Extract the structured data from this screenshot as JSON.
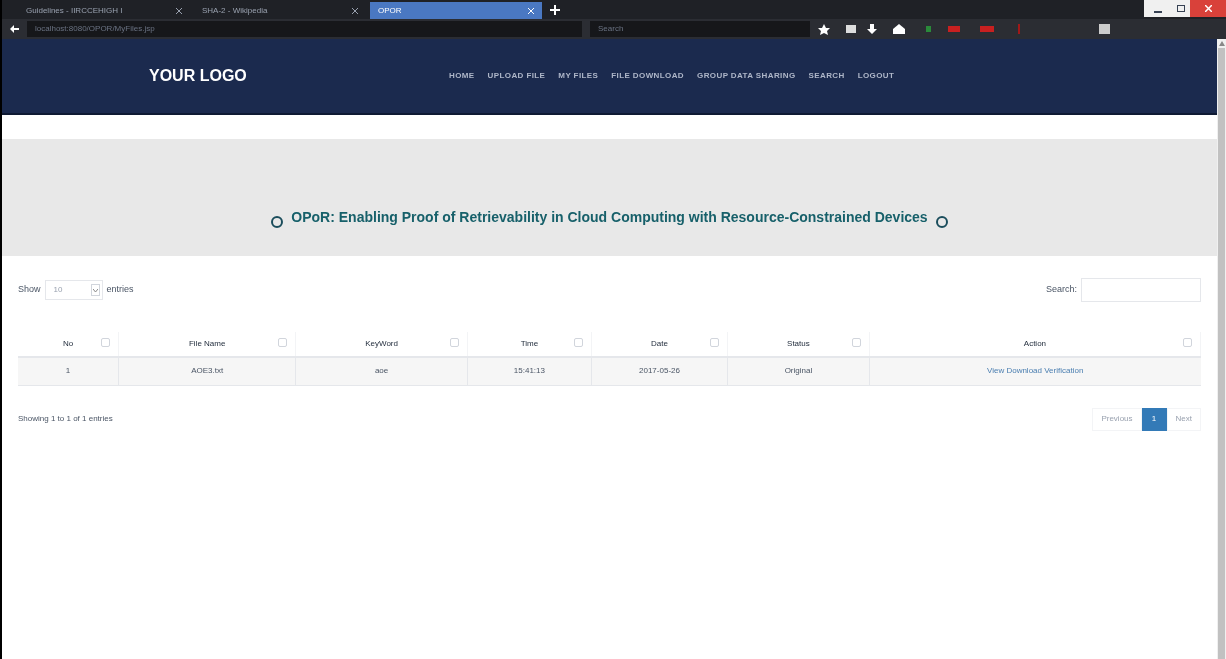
{
  "browser": {
    "tabs": [
      {
        "title": "Guidelines - IIRCCEHIGH I",
        "selected": false
      },
      {
        "title": "SHA-2 - Wikipedia",
        "selected": false
      },
      {
        "title": "OPOR",
        "selected": true
      }
    ],
    "url": "localhost:8080/OPOR/MyFiles.jsp",
    "search_placeholder": "Search"
  },
  "navbar": {
    "logo": "YOUR LOGO",
    "items": [
      "HOME",
      "UPLOAD FILE",
      "MY FILES",
      "FILE DOWNLOAD",
      "GROUP DATA SHARING",
      "SEARCH",
      "LOGOUT"
    ]
  },
  "banner": {
    "title": "OPoR: Enabling Proof of Retrievability in Cloud Computing with Resource-Constrained Devices"
  },
  "length_control": {
    "before": "Show",
    "value": "10",
    "after": "entries"
  },
  "search": {
    "label": "Search:"
  },
  "table": {
    "columns": [
      "No",
      "File Name",
      "KeyWord",
      "Time",
      "Date",
      "Status",
      "Action"
    ],
    "rows": [
      {
        "cells": [
          "1",
          "AOE3.txt",
          "aoe",
          "15:41:13",
          "2017-05-26",
          "Original"
        ],
        "action": "View Download Verification"
      }
    ]
  },
  "info": "Showing 1 to 1 of 1 entries",
  "pagination": {
    "previous": "Previous",
    "pages": [
      {
        "label": "1",
        "selected": true
      }
    ],
    "next": "Next"
  }
}
